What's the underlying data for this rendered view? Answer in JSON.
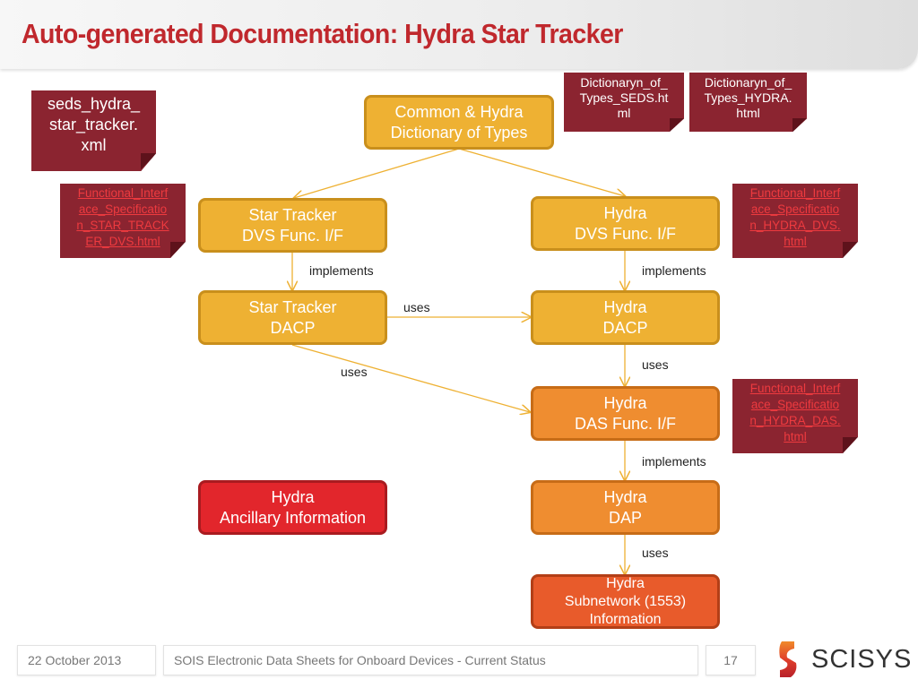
{
  "slide": {
    "title": "Auto-generated Documentation: Hydra Star Tracker"
  },
  "files": {
    "xml_source": [
      "seds_hydra_",
      "star_tracker.",
      "xml"
    ],
    "dict_seds": [
      "Dictionaryn_of_",
      "Types_SEDS.ht",
      "ml"
    ],
    "dict_hydra": [
      "Dictionaryn_of_",
      "Types_HYDRA.",
      "html"
    ],
    "fis_star_tracker_dvs": [
      "Functional_Interf",
      "ace_Specificatio",
      "n_STAR_TRACK",
      "ER_DVS.html"
    ],
    "fis_hydra_dvs": [
      "Functional_Interf",
      "ace_Specificatio",
      "n_HYDRA_DVS.",
      "html"
    ],
    "fis_hydra_das": [
      "Functional_Interf",
      "ace_Specificatio",
      "n_HYDRA_DAS.",
      "html"
    ]
  },
  "nodes": {
    "dictionary": [
      "Common & Hydra",
      "Dictionary of Types"
    ],
    "st_dvs": [
      "Star Tracker",
      "DVS Func. I/F"
    ],
    "hy_dvs": [
      "Hydra",
      "DVS Func. I/F"
    ],
    "st_dacp": [
      "Star Tracker",
      "DACP"
    ],
    "hy_dacp": [
      "Hydra",
      "DACP"
    ],
    "hy_das": [
      "Hydra",
      "DAS Func. I/F"
    ],
    "hy_ancillary": [
      "Hydra",
      "Ancillary Information"
    ],
    "hy_dap": [
      "Hydra",
      "DAP"
    ],
    "hy_subnet": [
      "Hydra",
      "Subnetwork (1553)",
      "Information"
    ]
  },
  "edge_labels": {
    "st_dvs_to_st_dacp": "implements",
    "hy_dvs_to_hy_dacp": "implements",
    "st_dacp_to_hy_dacp": "uses",
    "st_dacp_to_hy_das": "uses",
    "hy_dacp_to_hy_das": "uses",
    "hy_das_to_hy_dap": "implements",
    "hy_dap_to_hy_subnet": "uses"
  },
  "colors": {
    "title": "#c0282d",
    "interface_node": "#eeb133",
    "das_node": "#ef8d30",
    "ancillary_node": "#e2262c",
    "subnetwork_node": "#e85b2b",
    "file_note": "#8b2430",
    "file_link_text": "#ee3a3f",
    "arrow": "#eeb133"
  },
  "footer": {
    "date": "22 October 2013",
    "presentation_title": "SOIS Electronic Data Sheets for Onboard Devices - Current Status",
    "page_number": "17",
    "logo_text": "SCISYS"
  }
}
